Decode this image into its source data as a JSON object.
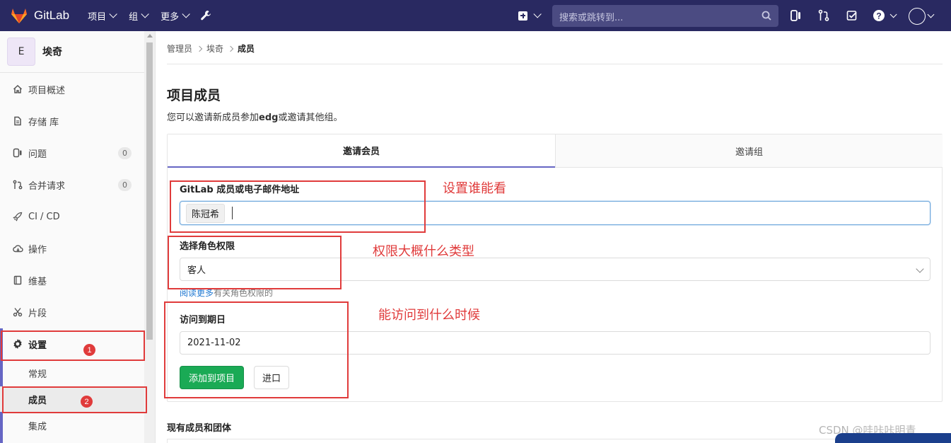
{
  "navbar": {
    "brand": "GitLab",
    "menu": [
      {
        "label": "项目"
      },
      {
        "label": "组"
      },
      {
        "label": "更多"
      }
    ],
    "search_placeholder": "搜索或跳转到..."
  },
  "sidebar": {
    "project_initial": "E",
    "project_name": "埃奇",
    "items": [
      {
        "label": "项目概述",
        "icon": "home-icon"
      },
      {
        "label": "存储 库",
        "icon": "file-icon"
      },
      {
        "label": "问题",
        "icon": "issues-icon",
        "count": "0"
      },
      {
        "label": "合并请求",
        "icon": "merge-request-icon",
        "count": "0"
      },
      {
        "label": "CI / CD",
        "icon": "rocket-icon"
      },
      {
        "label": "操作",
        "icon": "cloud-icon"
      },
      {
        "label": "维基",
        "icon": "book-icon"
      },
      {
        "label": "片段",
        "icon": "scissors-icon"
      },
      {
        "label": "设置",
        "icon": "gear-icon"
      }
    ],
    "sub_items": [
      {
        "label": "常规"
      },
      {
        "label": "成员"
      },
      {
        "label": "集成"
      }
    ]
  },
  "annotations": {
    "badge1": "1",
    "badge2": "2",
    "note_who": "设置谁能看",
    "note_role": "权限大概什么类型",
    "note_expiry": "能访问到什么时候"
  },
  "breadcrumb": [
    "管理员",
    "埃奇",
    "成员"
  ],
  "main": {
    "title": "项目成员",
    "desc_prefix": "您可以邀请新成员参加",
    "desc_project": "edg",
    "desc_suffix": "或邀请其他组。",
    "tabs": [
      {
        "label": "邀请会员"
      },
      {
        "label": "邀请组"
      }
    ],
    "member_label": "GitLab 成员或电子邮件地址",
    "member_token": "陈冠希",
    "role_label": "选择角色权限",
    "role_value": "客人",
    "help_link": "阅读更多",
    "help_text": "有关角色权限的",
    "expiry_label": "访问到期日",
    "expiry_value": "2021-11-02",
    "add_button": "添加到项目",
    "import_button": "进口",
    "existing_title": "现有成员和团体"
  },
  "watermark": "CSDN @哇咔咔明青",
  "colors": {
    "navbar": "#292961",
    "accent": "#6666c4",
    "success": "#1aaa55",
    "annotation": "#e03b3b"
  }
}
